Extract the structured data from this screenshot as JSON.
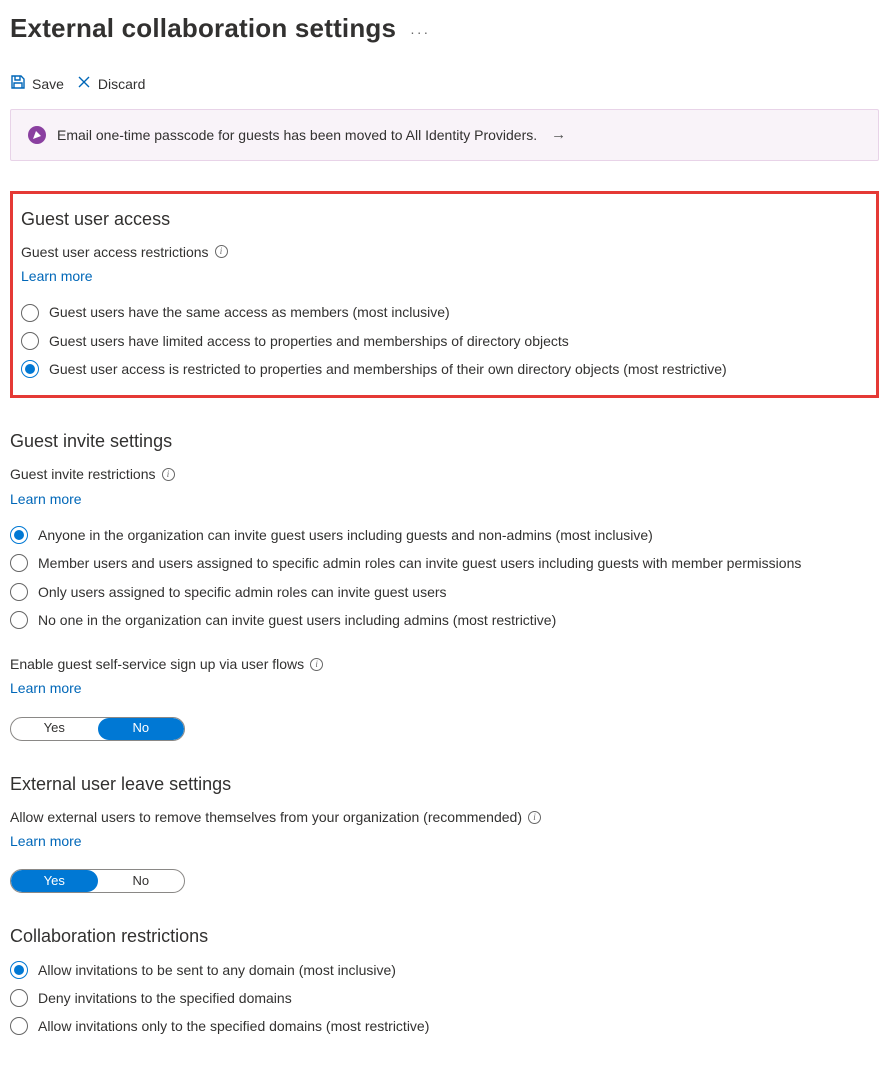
{
  "page": {
    "title": "External collaboration settings",
    "more_menu": "···"
  },
  "toolbar": {
    "save_label": "Save",
    "discard_label": "Discard"
  },
  "banner": {
    "text": "Email one-time passcode for guests has been moved to All Identity Providers.",
    "arrow": "→"
  },
  "sections": {
    "guest_access": {
      "heading": "Guest user access",
      "field_label": "Guest user access restrictions",
      "learn_more": "Learn more",
      "options": [
        "Guest users have the same access as members (most inclusive)",
        "Guest users have limited access to properties and memberships of directory objects",
        "Guest user access is restricted to properties and memberships of their own directory objects (most restrictive)"
      ],
      "selected_index": 2
    },
    "guest_invite": {
      "heading": "Guest invite settings",
      "field_label": "Guest invite restrictions",
      "learn_more": "Learn more",
      "options": [
        "Anyone in the organization can invite guest users including guests and non-admins (most inclusive)",
        "Member users and users assigned to specific admin roles can invite guest users including guests with member permissions",
        "Only users assigned to specific admin roles can invite guest users",
        "No one in the organization can invite guest users including admins (most restrictive)"
      ],
      "selected_index": 0,
      "self_service": {
        "label": "Enable guest self-service sign up via user flows",
        "learn_more": "Learn more",
        "yes": "Yes",
        "no": "No",
        "value": "No"
      }
    },
    "external_leave": {
      "heading": "External user leave settings",
      "field_label": "Allow external users to remove themselves from your organization (recommended)",
      "learn_more": "Learn more",
      "yes": "Yes",
      "no": "No",
      "value": "Yes"
    },
    "collab_restrictions": {
      "heading": "Collaboration restrictions",
      "options": [
        "Allow invitations to be sent to any domain (most inclusive)",
        "Deny invitations to the specified domains",
        "Allow invitations only to the specified domains (most restrictive)"
      ],
      "selected_index": 0
    }
  }
}
